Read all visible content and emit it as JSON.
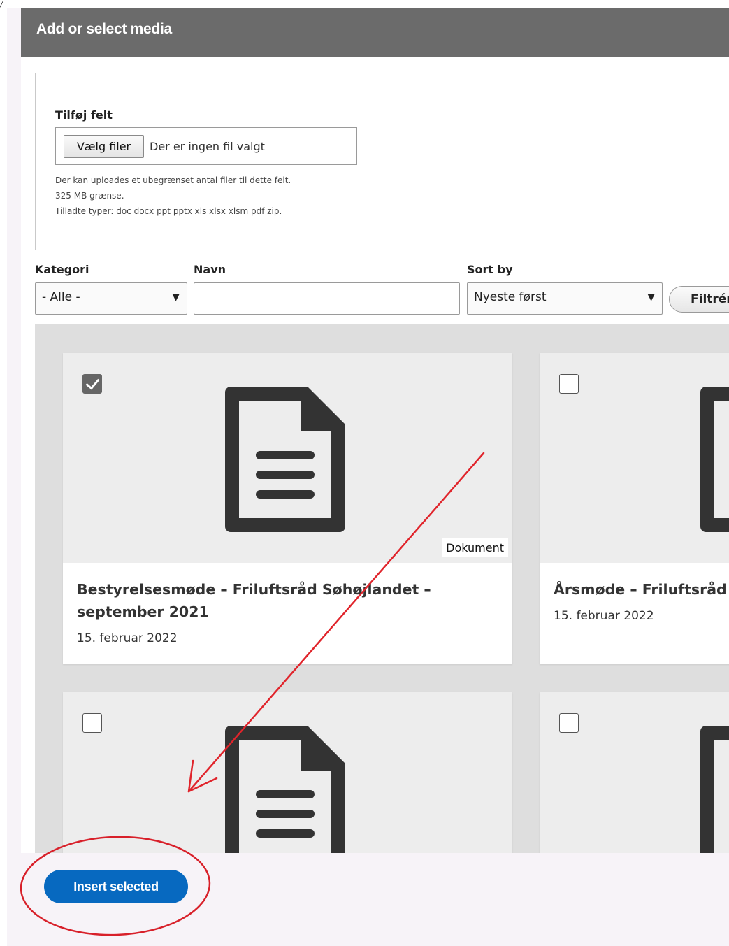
{
  "page_corner_mark": "/",
  "dialog": {
    "title": "Add or select media",
    "upload": {
      "label": "Tilføj felt",
      "choose_button": "Vælg filer",
      "file_status": "Der er ingen fil valgt",
      "help_lines": [
        "Der kan uploades et ubegrænset antal filer til dette felt.",
        "325 MB grænse.",
        "Tilladte typer: doc docx ppt pptx xls xlsx xlsm pdf zip."
      ]
    },
    "filters": {
      "category_label": "Kategori",
      "category_value": "- Alle -",
      "name_label": "Navn",
      "name_value": "",
      "sort_label": "Sort by",
      "sort_value": "Nyeste først",
      "filter_button": "Filtrér"
    },
    "media_items": [
      {
        "title": "Bestyrelsesmøde – Friluftsråd Søhøjlandet – september 2021",
        "date": "15. februar 2022",
        "type": "Dokument",
        "selected": true
      },
      {
        "title": "Årsmøde – Friluftsråd (",
        "date": "15. februar 2022",
        "type": "",
        "selected": false
      },
      {
        "title": "",
        "date": "",
        "type": "",
        "selected": false
      },
      {
        "title": "",
        "date": "",
        "type": "",
        "selected": false
      }
    ]
  },
  "footer": {
    "insert_button": "Insert selected"
  },
  "annotation_colors": {
    "arrow": "#e0242b",
    "circle": "#d8202a"
  },
  "colors": {
    "titlebar": "#6b6b6b",
    "primary_button": "#0769c0",
    "grid_background": "#dedede"
  }
}
